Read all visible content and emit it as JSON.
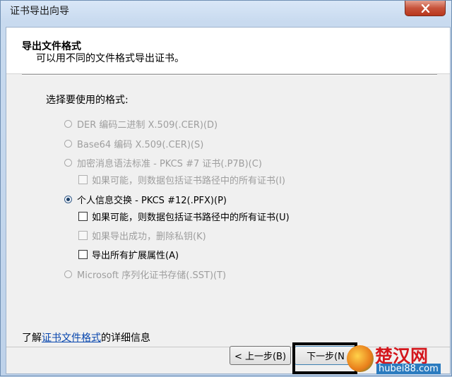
{
  "window": {
    "title": "证书导出向导",
    "close_icon": "close-icon"
  },
  "header": {
    "title": "导出文件格式",
    "subtitle": "可以用不同的文件格式导出证书。"
  },
  "format_group": {
    "label": "选择要使用的格式:",
    "options": [
      {
        "label": "DER 编码二进制 X.509(.CER)(D)",
        "type": "radio",
        "checked": false,
        "enabled": false
      },
      {
        "label": "Base64 编码 X.509(.CER)(S)",
        "type": "radio",
        "checked": false,
        "enabled": false
      },
      {
        "label": "加密消息语法标准 - PKCS #7 证书(.P7B)(C)",
        "type": "radio",
        "checked": false,
        "enabled": false
      },
      {
        "label": "如果可能，则数据包括证书路径中的所有证书(I)",
        "type": "checkbox",
        "checked": false,
        "enabled": false
      },
      {
        "label": "个人信息交换 - PKCS #12(.PFX)(P)",
        "type": "radio",
        "checked": true,
        "enabled": true
      },
      {
        "label": "如果可能，则数据包括证书路径中的所有证书(U)",
        "type": "checkbox",
        "checked": false,
        "enabled": true
      },
      {
        "label": "如果导出成功，删除私钥(K)",
        "type": "checkbox",
        "checked": false,
        "enabled": false
      },
      {
        "label": "导出所有扩展属性(A)",
        "type": "checkbox",
        "checked": false,
        "enabled": true
      },
      {
        "label": "Microsoft 序列化证书存储(.SST)(T)",
        "type": "radio",
        "checked": false,
        "enabled": false
      }
    ]
  },
  "info": {
    "prefix": "了解",
    "link": "证书文件格式",
    "suffix": "的详细信息"
  },
  "buttons": {
    "back": "< 上一步(B)",
    "next": "下一步(N"
  },
  "watermark": {
    "text": "楚汉网",
    "url": "hubei88.com"
  }
}
